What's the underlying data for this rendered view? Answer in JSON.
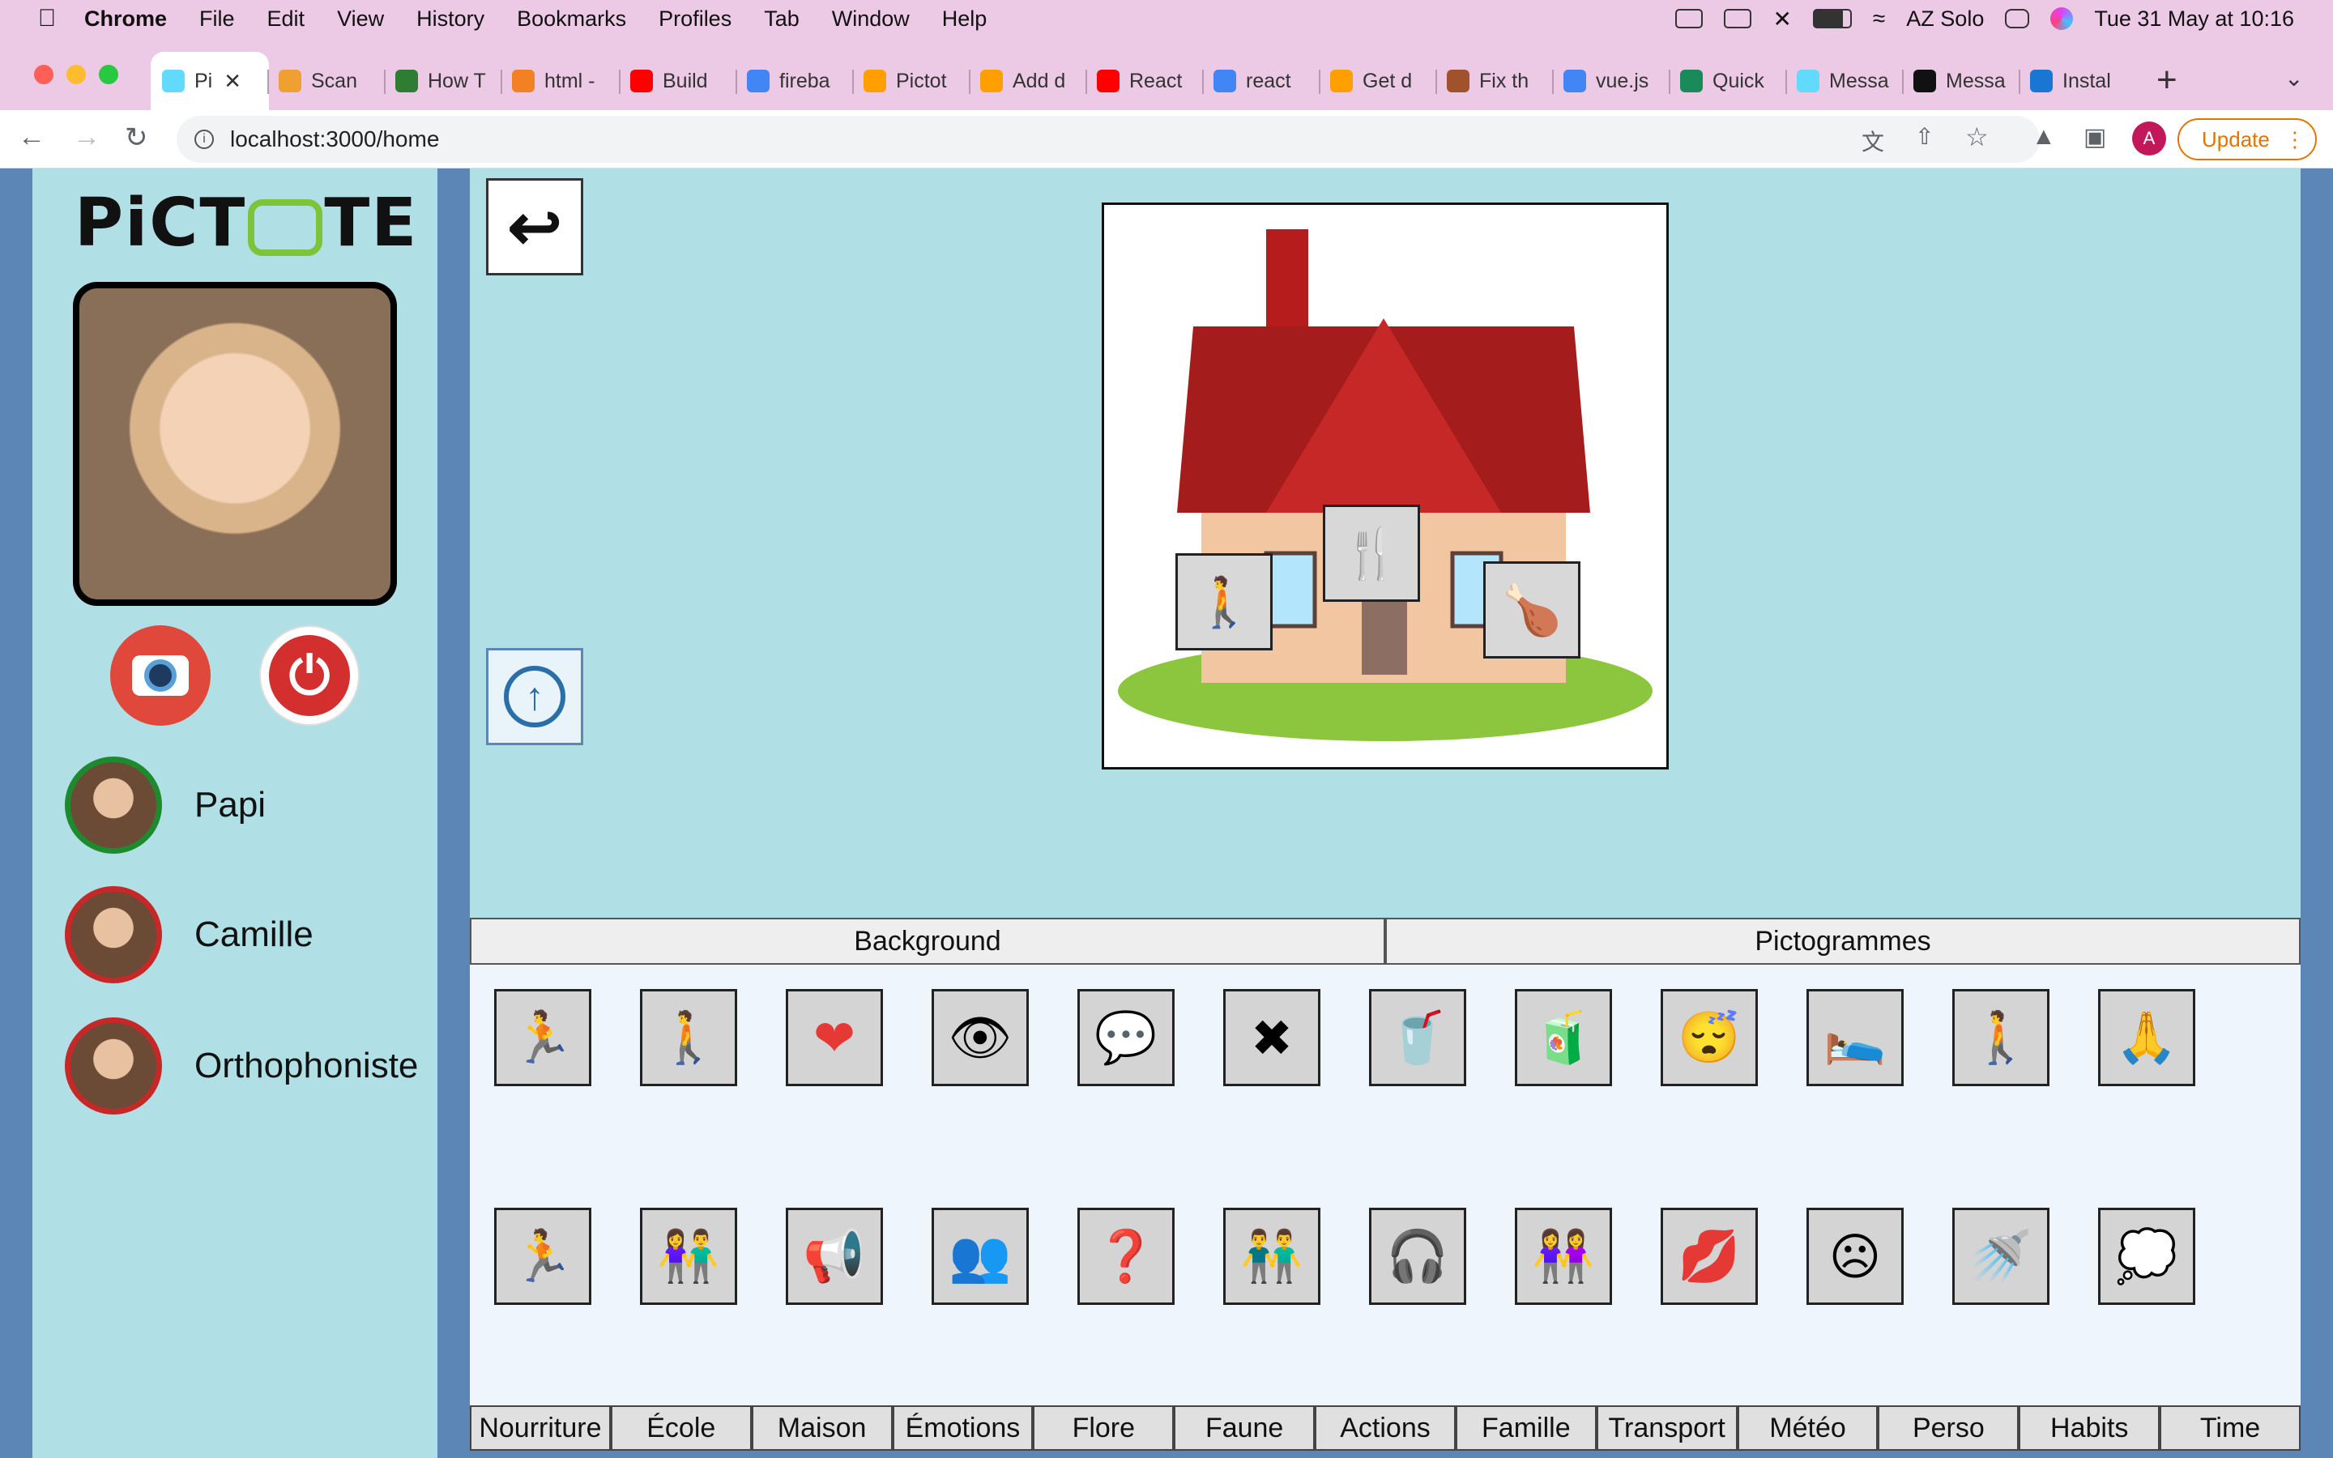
{
  "menubar": {
    "app": "Chrome",
    "items": [
      "File",
      "Edit",
      "View",
      "History",
      "Bookmarks",
      "Profiles",
      "Tab",
      "Window",
      "Help"
    ],
    "user": "AZ Solo",
    "datetime": "Tue 31 May at  10:16"
  },
  "tabs": [
    {
      "title": "Pi",
      "icon": "react-icon",
      "color": "#61dafb"
    },
    {
      "title": "Scan",
      "icon": "scan-icon",
      "color": "#f0a030"
    },
    {
      "title": "How T",
      "icon": "w3-icon",
      "color": "#2e7d32"
    },
    {
      "title": "html -",
      "icon": "stackoverflow-icon",
      "color": "#f48024"
    },
    {
      "title": "Build",
      "icon": "youtube-icon",
      "color": "#ff0000"
    },
    {
      "title": "fireba",
      "icon": "google-icon",
      "color": "#4285f4"
    },
    {
      "title": "Pictot",
      "icon": "firebase-icon",
      "color": "#ffa000"
    },
    {
      "title": "Add d",
      "icon": "firebase-icon",
      "color": "#ffa000"
    },
    {
      "title": "React",
      "icon": "youtube-icon",
      "color": "#ff0000"
    },
    {
      "title": "react",
      "icon": "google-icon",
      "color": "#4285f4"
    },
    {
      "title": "Get d",
      "icon": "firebase-icon",
      "color": "#ffa000"
    },
    {
      "title": "Fix th",
      "icon": "profile-icon",
      "color": "#a0522d"
    },
    {
      "title": "vue.js",
      "icon": "google-icon",
      "color": "#4285f4"
    },
    {
      "title": "Quick",
      "icon": "vuetify-icon",
      "color": "#1b8a5a"
    },
    {
      "title": "Messa",
      "icon": "react-icon",
      "color": "#61dafb"
    },
    {
      "title": "Messa",
      "icon": "github-icon",
      "color": "#111111"
    },
    {
      "title": "Instal",
      "icon": "mui-icon",
      "color": "#1976d2"
    }
  ],
  "address": {
    "url": "localhost:3000/home",
    "update_label": "Update",
    "avatar_letter": "A"
  },
  "app": {
    "logo": {
      "before": "PiCT",
      "after": "TE"
    },
    "contacts": [
      {
        "name": "Papi",
        "ring": "#1e8a2e"
      },
      {
        "name": "Camille",
        "ring": "#c62828"
      },
      {
        "name": "Orthophoniste",
        "ring": "#c62828"
      }
    ],
    "toggles": [
      "Background",
      "Pictogrammes"
    ],
    "categories": [
      "Nourriture",
      "École",
      "Maison",
      "Émotions",
      "Flore",
      "Faune",
      "Actions",
      "Famille",
      "Transport",
      "Météo",
      "Perso",
      "Habits",
      "Time"
    ],
    "pictograms_row1": [
      "run-icon",
      "walk-icon",
      "heart-icon",
      "eye-icon",
      "talk-icon",
      "broken-heart-icon",
      "drink-icon",
      "drink-straw-icon",
      "sleep-icon",
      "sleep-bed-icon",
      "go-icon",
      "clap-icon"
    ],
    "pictograms_row2": [
      "slip-icon",
      "meet-icon",
      "shout-icon",
      "sad-group-icon",
      "question-icon",
      "argue-icon",
      "music-icon",
      "exchange-icon",
      "kiss-icon",
      "sad-face-icon",
      "wash-icon",
      "dream-icon"
    ],
    "scene_pictograms": [
      "go-icon",
      "eat-icon",
      "chicken-leg-icon"
    ],
    "accent": "#b0e0e6"
  }
}
